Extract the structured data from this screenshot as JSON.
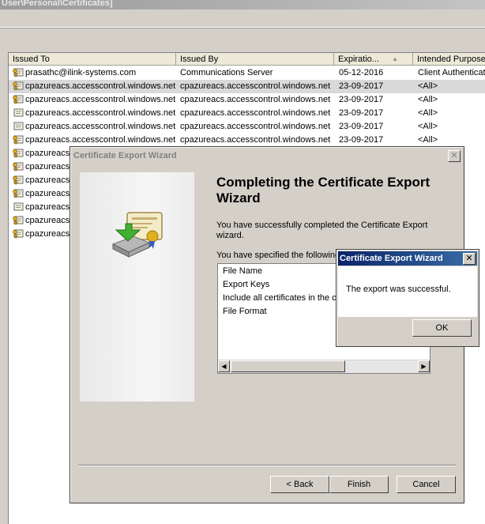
{
  "window": {
    "title_fragment": "User\\Personal\\Certificates]"
  },
  "columns": [
    "Issued To",
    "Issued By",
    "Expiratio...",
    "Intended Purpose"
  ],
  "rows": [
    {
      "issued_to": "prasathc@ilink-systems.com",
      "issued_by": "Communications Server",
      "expiration": "05-12-2016",
      "purpose": "Client Authenticati",
      "icon": "certificate-key-icon"
    },
    {
      "issued_to": "cpazureacs.accesscontrol.windows.net",
      "issued_by": "cpazureacs.accesscontrol.windows.net",
      "expiration": "23-09-2017",
      "purpose": "<All>",
      "icon": "certificate-key-icon"
    },
    {
      "issued_to": "cpazureacs.accesscontrol.windows.net",
      "issued_by": "cpazureacs.accesscontrol.windows.net",
      "expiration": "23-09-2017",
      "purpose": "<All>",
      "icon": "certificate-key-icon"
    },
    {
      "issued_to": "cpazureacs.accesscontrol.windows.net",
      "issued_by": "cpazureacs.accesscontrol.windows.net",
      "expiration": "23-09-2017",
      "purpose": "<All>",
      "icon": "certificate-icon"
    },
    {
      "issued_to": "cpazureacs.accesscontrol.windows.net",
      "issued_by": "cpazureacs.accesscontrol.windows.net",
      "expiration": "23-09-2017",
      "purpose": "<All>",
      "icon": "certificate-icon"
    },
    {
      "issued_to": "cpazureacs.accesscontrol.windows.net",
      "issued_by": "cpazureacs.accesscontrol.windows.net",
      "expiration": "23-09-2017",
      "purpose": "<All>",
      "icon": "certificate-key-icon"
    },
    {
      "issued_to": "cpazureacs",
      "issued_by": "",
      "expiration": "",
      "purpose": "",
      "icon": "certificate-key-icon"
    },
    {
      "issued_to": "cpazureacs",
      "issued_by": "",
      "expiration": "",
      "purpose": "",
      "icon": "certificate-key-icon"
    },
    {
      "issued_to": "cpazureacs",
      "issued_by": "",
      "expiration": "",
      "purpose": "",
      "icon": "certificate-key-icon"
    },
    {
      "issued_to": "cpazureacs",
      "issued_by": "",
      "expiration": "",
      "purpose": "",
      "icon": "certificate-key-icon"
    },
    {
      "issued_to": "cpazureacs",
      "issued_by": "",
      "expiration": "",
      "purpose": "",
      "icon": "certificate-icon"
    },
    {
      "issued_to": "cpazureacs",
      "issued_by": "",
      "expiration": "",
      "purpose": "",
      "icon": "certificate-key-icon"
    },
    {
      "issued_to": "cpazureacs",
      "issued_by": "",
      "expiration": "",
      "purpose": "",
      "icon": "certificate-key-icon"
    }
  ],
  "wizard": {
    "title": "Certificate Export Wizard",
    "heading": "Completing the Certificate Export Wizard",
    "success_text": "You have successfully completed the Certificate Export wizard.",
    "specified_text": "You have specified the following",
    "summary_items": [
      "File Name",
      "Export Keys",
      "Include all certificates in the c",
      "File Format"
    ],
    "buttons": {
      "back": "< Back",
      "finish": "Finish",
      "cancel": "Cancel"
    }
  },
  "message_box": {
    "title": "Certificate Export Wizard",
    "message": "The export was successful.",
    "ok": "OK"
  },
  "colors": {
    "active_title": "#0a246a",
    "selected_row": "#d9d9d9",
    "dialog_face": "#d4d0c8"
  }
}
